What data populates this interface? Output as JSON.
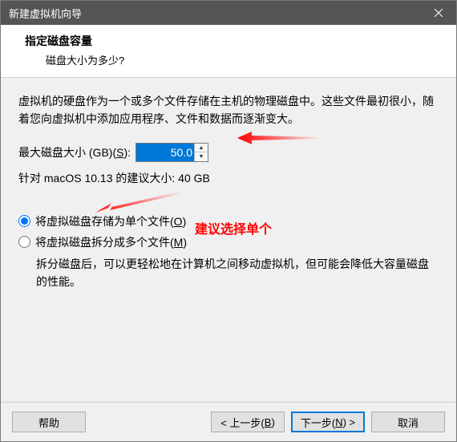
{
  "titlebar": {
    "title": "新建虚拟机向导"
  },
  "header": {
    "title": "指定磁盘容量",
    "subtitle": "磁盘大小为多少?"
  },
  "content": {
    "description": "虚拟机的硬盘作为一个或多个文件存储在主机的物理磁盘中。这些文件最初很小，随着您向虚拟机中添加应用程序、文件和数据而逐渐变大。",
    "size_label_pre": "最大磁盘大小 (GB)(",
    "size_label_key": "S",
    "size_label_post": "):",
    "size_value": "50.0",
    "recommend": "针对 macOS 10.13 的建议大小: 40 GB",
    "radio1_pre": "将虚拟磁盘存储为单个文件(",
    "radio1_key": "O",
    "radio1_post": ")",
    "radio2_pre": "将虚拟磁盘拆分成多个文件(",
    "radio2_key": "M",
    "radio2_post": ")",
    "radio_note": "拆分磁盘后，可以更轻松地在计算机之间移动虚拟机，但可能会降低大容量磁盘的性能。",
    "annotation": "建议选择单个"
  },
  "footer": {
    "help": "帮助",
    "back_pre": "< 上一步(",
    "back_key": "B",
    "back_post": ")",
    "next_pre": "下一步(",
    "next_key": "N",
    "next_post": ") >",
    "cancel": "取消"
  }
}
